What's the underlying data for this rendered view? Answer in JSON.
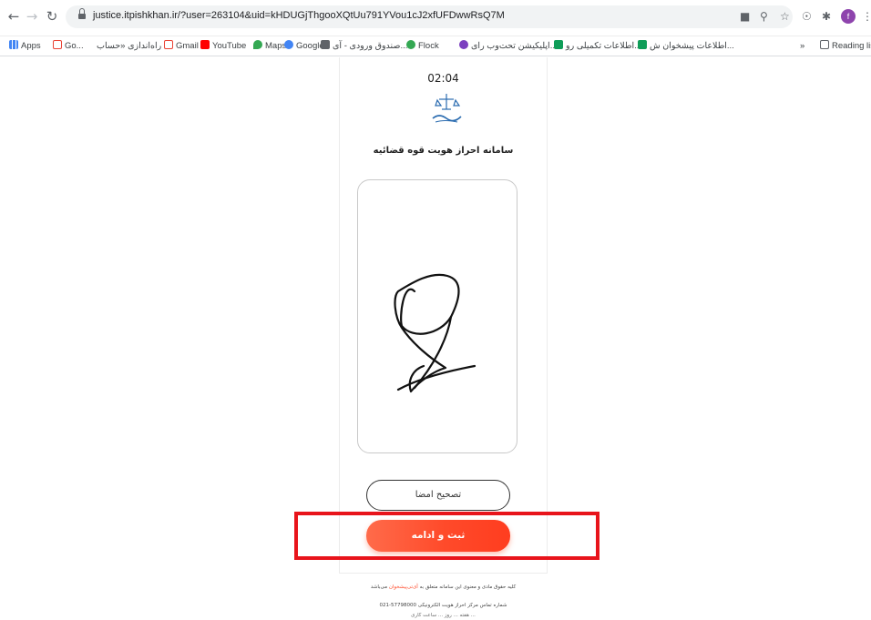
{
  "browser": {
    "url": "justice.itpishkhan.ir/?user=263104&uid=kHDUGjThgooXQtUu791YVou1cJ2xfUFDwwRsQ7M",
    "profile_initial": "f"
  },
  "bookmarks": {
    "apps": "Apps",
    "items": [
      {
        "label": "Go...",
        "icon": "gmail-icon"
      },
      {
        "label": "راه‌اندازی «حساب ...",
        "icon": ""
      },
      {
        "label": "Gmail",
        "icon": "gmail-icon"
      },
      {
        "label": "YouTube",
        "icon": "youtube-icon"
      },
      {
        "label": "Maps",
        "icon": "maps-icon"
      },
      {
        "label": "Google",
        "icon": "google-icon"
      },
      {
        "label": "صندوق ورودی - آی...",
        "icon": "mail-icon"
      },
      {
        "label": "Flock",
        "icon": "flock-icon"
      },
      {
        "label": "اپلیکیشن تحت‌وب رای...",
        "icon": "app-icon"
      },
      {
        "label": "اطلاعات تکمیلی رو...",
        "icon": "sheet-icon"
      },
      {
        "label": "اطلاعات پیشخوان ش...",
        "icon": "sheet-icon"
      }
    ],
    "overflow": "»",
    "reading_list": "Reading lis"
  },
  "page": {
    "timer": "02:04",
    "title": "سامانه احراز هویت قوه قضائیه",
    "correct_signature": "تصحیح امضا",
    "submit": "ثبت و ادامه",
    "footer_line1_pre": "کلیه حقوق مادی و معنوی این سامانه متعلق به",
    "footer_line1_brand": "آی‌تی‌پیشخوان",
    "footer_line1_post": "می‌باشد",
    "footer_line2": "021-57798000 شماره تماس مرکز احراز هویت الکترونیکی",
    "footer_line3": "هفته ... روز ... ساعت کاری ..."
  },
  "colors": {
    "accent": "#ff4a2a",
    "highlight": "#e8141b"
  }
}
